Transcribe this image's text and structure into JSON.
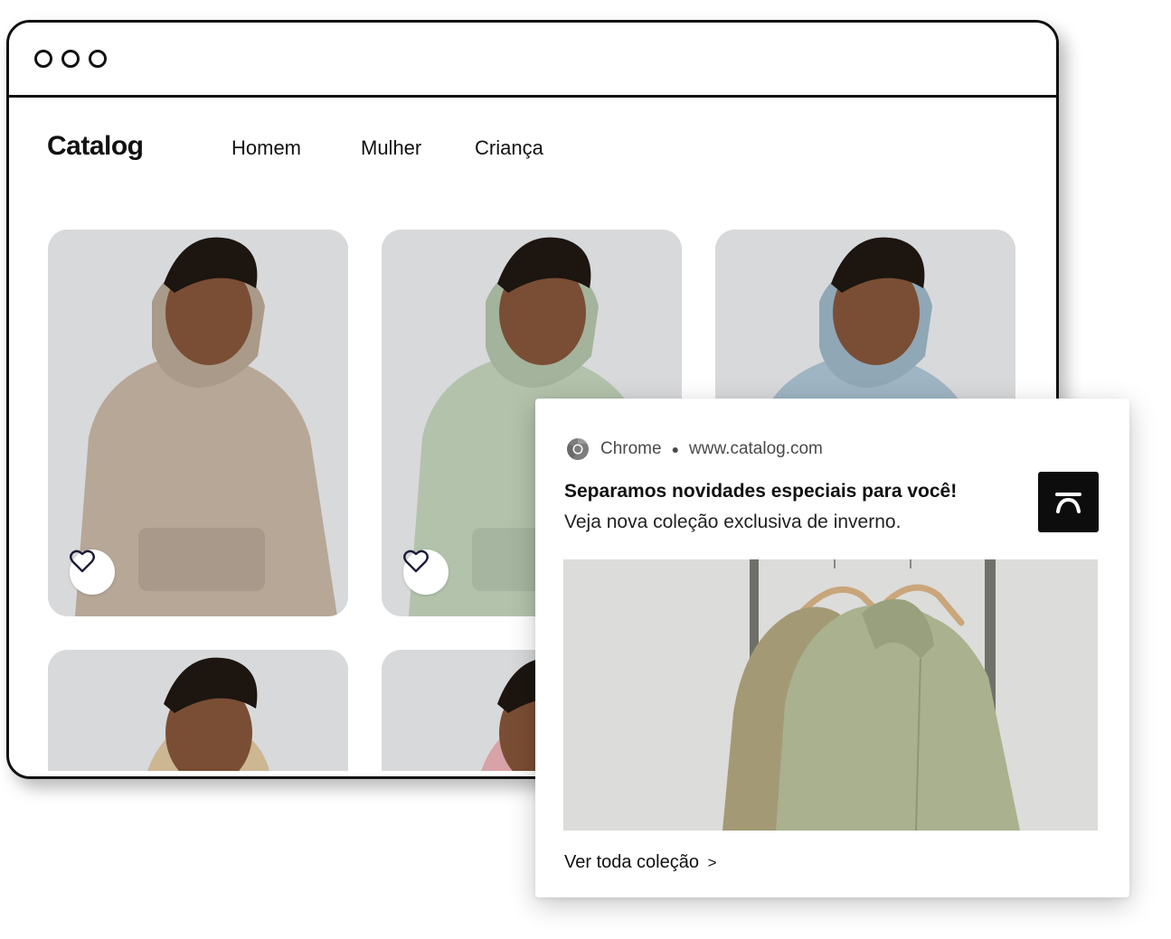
{
  "browser": {
    "brand": "Catalog",
    "nav": [
      "Homem",
      "Mulher",
      "Criança"
    ]
  },
  "products": [
    {
      "color": "#b7a796",
      "favorite_icon": "heart-outline-icon"
    },
    {
      "color": "#b3c2ab",
      "favorite_icon": "heart-outline-icon"
    },
    {
      "color": "#9fb5c3"
    },
    {
      "color": "#cdb692"
    },
    {
      "color": "#d8a3a6"
    }
  ],
  "notification": {
    "source_app": "Chrome",
    "source_url": "www.catalog.com",
    "title": "Separamos novidades especiais para você!",
    "body": "Veja nova coleção exclusiva de inverno.",
    "link": "Ver toda coleção",
    "link_chevron": ">",
    "app_icon": "catalog-logo-icon",
    "image_description_colors": {
      "green": "#a9b18e",
      "khaki": "#a39a75",
      "rack": "#6e7068"
    }
  }
}
